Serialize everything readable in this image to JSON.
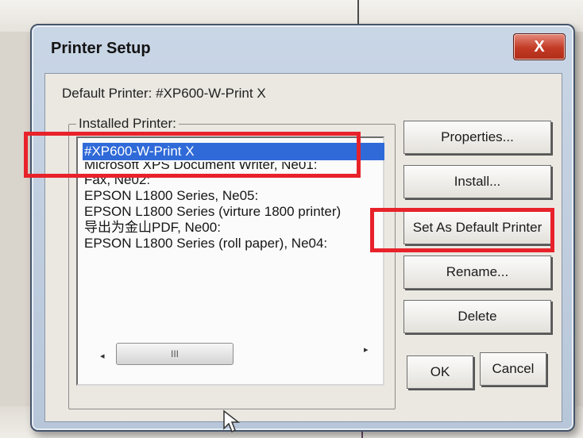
{
  "dialog": {
    "title": "Printer Setup",
    "close_glyph": "X",
    "default_printer_text": "Default Printer: #XP600-W-Print X",
    "group_label": "Installed Printer:"
  },
  "printers": [
    "#XP600-W-Print X",
    "Microsoft XPS Document Writer, Ne01:",
    "Fax, Ne02:",
    "EPSON L1800 Series, Ne05:",
    "EPSON L1800 Series (virture 1800 printer)",
    "导出为金山PDF, Ne00:",
    "EPSON L1800 Series (roll paper), Ne04:"
  ],
  "selected_index": 0,
  "scrollbar": {
    "left_arrow": "◂",
    "right_arrow": "▸",
    "thumb_grip": "III"
  },
  "buttons": {
    "properties": "Properties...",
    "install": "Install...",
    "set_default": "Set As Default Printer",
    "rename": "Rename...",
    "delete": "Delete",
    "ok": "OK",
    "cancel": "Cancel"
  },
  "colors": {
    "selection": "#2f6ad8",
    "highlight_box": "#e8222a",
    "close_button": "#c23a24"
  }
}
